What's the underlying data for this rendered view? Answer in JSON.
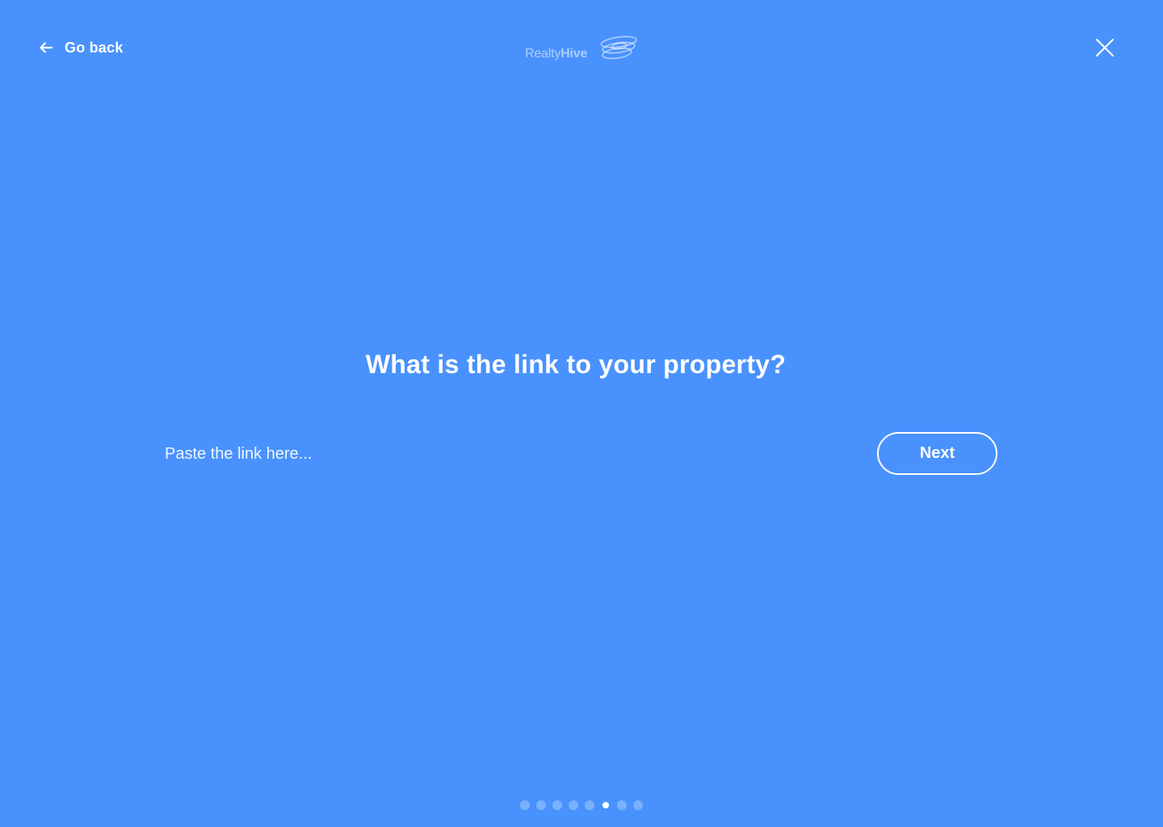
{
  "header": {
    "go_back_label": "Go back",
    "back_icon": "arrow-left-icon",
    "logo": {
      "text_light": "Realty",
      "text_bold": "Hive",
      "icon": "orbit-rings-logo-icon"
    },
    "close_icon": "close-icon"
  },
  "main": {
    "question": "What is the link to your property?",
    "link_input": {
      "placeholder": "Paste the link here...",
      "value": ""
    },
    "next_label": "Next"
  },
  "progress": {
    "total_steps": 8,
    "current_step": 6
  },
  "colors": {
    "background": "#4992FD",
    "foreground": "#FFFFFF"
  }
}
